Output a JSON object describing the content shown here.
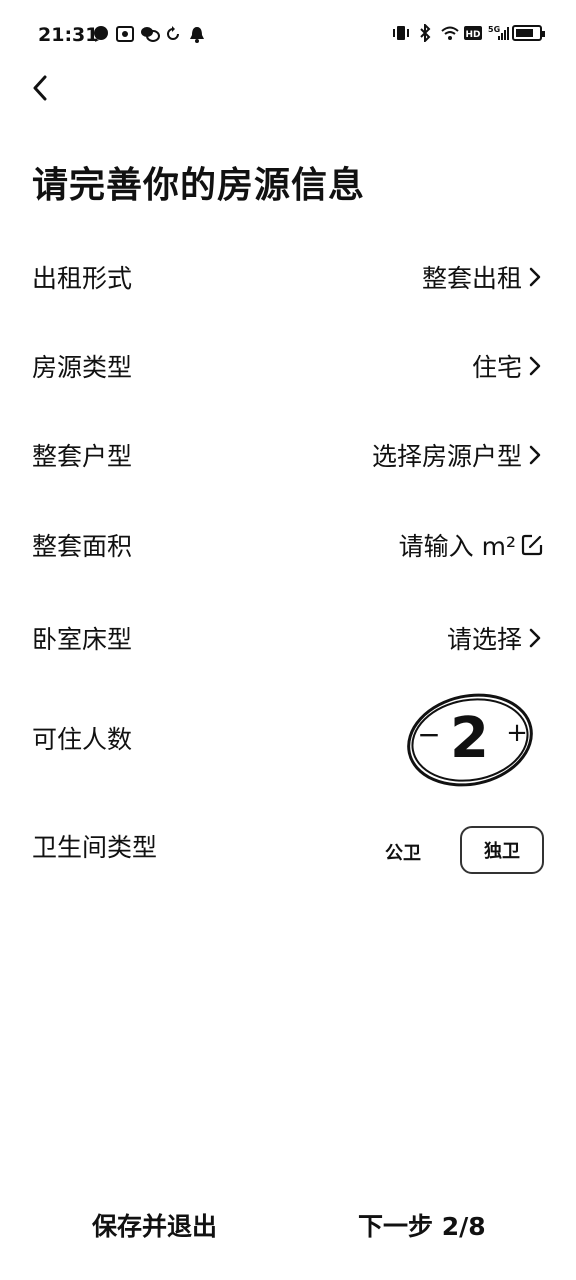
{
  "status_bar": {
    "time": "21:31",
    "left_icons": [
      "chat-icon",
      "photo-icon",
      "wechat-icon",
      "sync-icon",
      "notification-icon"
    ],
    "right_icons": [
      "vibrate-icon",
      "bluetooth-icon",
      "wifi-icon",
      "hd-icon",
      "signal-5g-icon",
      "battery-icon"
    ],
    "battery_level": 0.75
  },
  "header": {
    "back_icon": "chevron-left-icon"
  },
  "title": "请完善你的房源信息",
  "rows": [
    {
      "label": "出租形式",
      "value": "整套出租"
    },
    {
      "label": "房源类型",
      "value": "住宅"
    },
    {
      "label": "整套户型",
      "value": "选择房源户型"
    },
    {
      "label": "整套面积",
      "value": "请输入 m²"
    },
    {
      "label": "卧室床型",
      "value": "请选择"
    },
    {
      "label": "可住人数",
      "value": "2"
    },
    {
      "label": "卫生间类型",
      "options": [
        "公卫",
        "独卫"
      ],
      "selected": "独卫"
    }
  ],
  "stepper": {
    "minus": "−",
    "plus": "+"
  },
  "footer": {
    "save_exit": "保存并退出",
    "next_step": "下一步 2/8"
  }
}
